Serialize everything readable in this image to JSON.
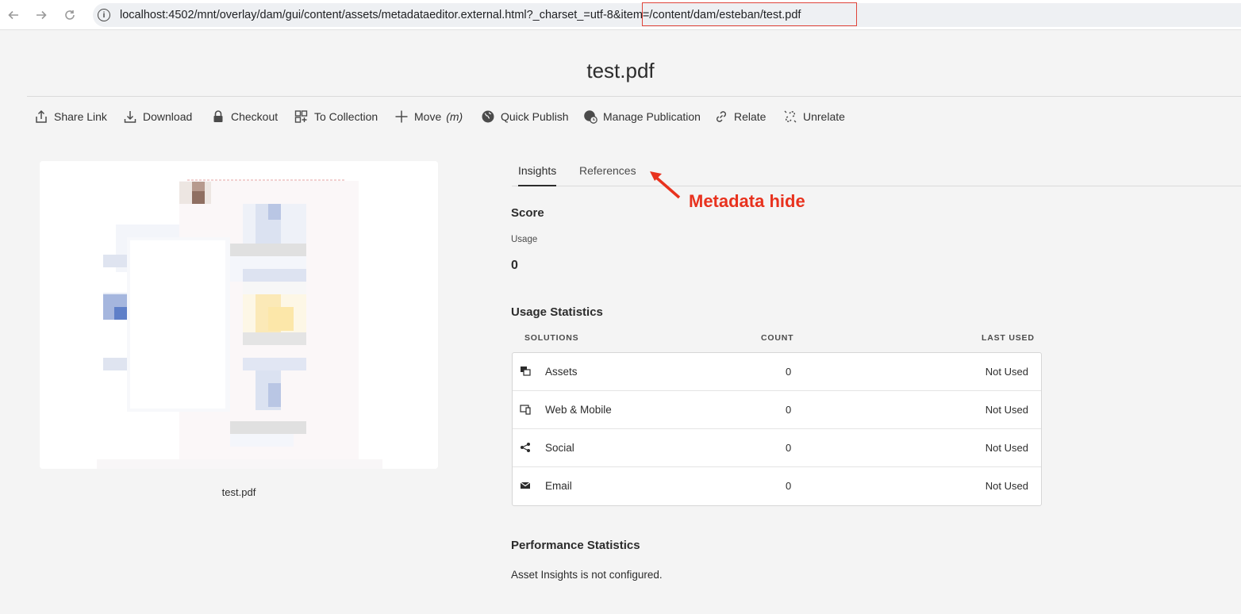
{
  "browser": {
    "url": "localhost:4502/mnt/overlay/dam/gui/content/assets/metadataeditor.external.html?_charset_=utf-8&item=/content/dam/esteban/test.pdf"
  },
  "page": {
    "title": "test.pdf"
  },
  "toolbar": {
    "share_link": "Share Link",
    "download": "Download",
    "checkout": "Checkout",
    "to_collection": "To Collection",
    "move": "Move",
    "move_shortcut": "(m)",
    "quick_publish": "Quick Publish",
    "manage_publication": "Manage Publication",
    "relate": "Relate",
    "unrelate": "Unrelate"
  },
  "preview": {
    "caption": "test.pdf"
  },
  "tabs": {
    "insights": "Insights",
    "references": "References"
  },
  "annotation": {
    "text": "Metadata hide",
    "color": "#e8321e"
  },
  "score": {
    "heading": "Score",
    "usage_label": "Usage",
    "usage_value": "0"
  },
  "usage_statistics": {
    "heading": "Usage Statistics",
    "columns": [
      "SOLUTIONS",
      "COUNT",
      "LAST USED"
    ],
    "rows": [
      {
        "icon": "assets-icon",
        "solution": "Assets",
        "count": "0",
        "last_used": "Not Used"
      },
      {
        "icon": "web-mobile-icon",
        "solution": "Web & Mobile",
        "count": "0",
        "last_used": "Not Used"
      },
      {
        "icon": "share-icon",
        "solution": "Social",
        "count": "0",
        "last_used": "Not Used"
      },
      {
        "icon": "email-icon",
        "solution": "Email",
        "count": "0",
        "last_used": "Not Used"
      }
    ]
  },
  "performance_statistics": {
    "heading": "Performance Statistics",
    "message": "Asset Insights is not configured."
  }
}
